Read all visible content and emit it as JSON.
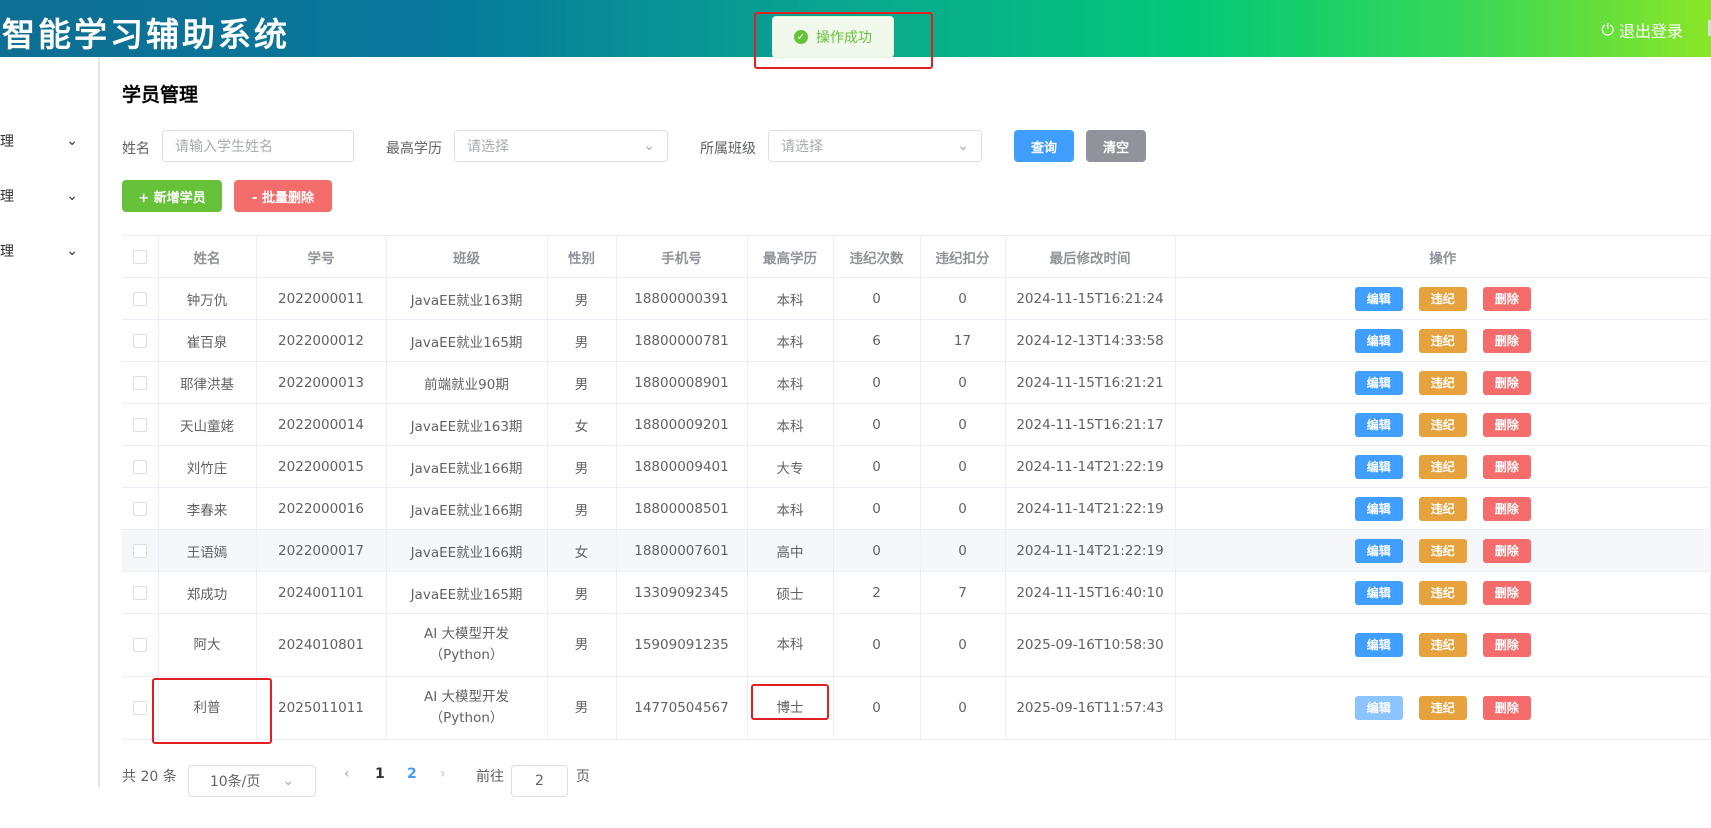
{
  "header": {
    "logo": "智能学习辅助系统",
    "logout": "退出登录"
  },
  "toast": {
    "message": "操作成功"
  },
  "sidebar": {
    "items": [
      {
        "label": "理"
      },
      {
        "label": "理"
      },
      {
        "label": "理"
      }
    ]
  },
  "page": {
    "title": "学员管理"
  },
  "search": {
    "name_label": "姓名",
    "name_placeholder": "请输入学生姓名",
    "degree_label": "最高学历",
    "degree_placeholder": "请选择",
    "class_label": "所属班级",
    "class_placeholder": "请选择",
    "query": "查询",
    "clear": "清空"
  },
  "actions": {
    "add": "+ 新增学员",
    "batch_delete": "- 批量删除"
  },
  "table": {
    "headers": [
      "姓名",
      "学号",
      "班级",
      "性别",
      "手机号",
      "最高学历",
      "违纪次数",
      "违纪扣分",
      "最后修改时间",
      "操作"
    ],
    "row_buttons": {
      "edit": "编辑",
      "violation": "违纪",
      "delete": "删除"
    },
    "rows": [
      [
        "钟万仇",
        "2022000011",
        "JavaEE就业163期",
        "男",
        "18800000391",
        "本科",
        "0",
        "0",
        "2024-11-15T16:21:24"
      ],
      [
        "崔百泉",
        "2022000012",
        "JavaEE就业165期",
        "男",
        "18800000781",
        "本科",
        "6",
        "17",
        "2024-12-13T14:33:58"
      ],
      [
        "耶律洪基",
        "2022000013",
        "前端就业90期",
        "男",
        "18800008901",
        "本科",
        "0",
        "0",
        "2024-11-15T16:21:21"
      ],
      [
        "天山童姥",
        "2022000014",
        "JavaEE就业163期",
        "女",
        "18800009201",
        "本科",
        "0",
        "0",
        "2024-11-15T16:21:17"
      ],
      [
        "刘竹庄",
        "2022000015",
        "JavaEE就业166期",
        "男",
        "18800009401",
        "大专",
        "0",
        "0",
        "2024-11-14T21:22:19"
      ],
      [
        "李春来",
        "2022000016",
        "JavaEE就业166期",
        "男",
        "18800008501",
        "本科",
        "0",
        "0",
        "2024-11-14T21:22:19"
      ],
      [
        "王语嫣",
        "2022000017",
        "JavaEE就业166期",
        "女",
        "18800007601",
        "高中",
        "0",
        "0",
        "2024-11-14T21:22:19"
      ],
      [
        "郑成功",
        "2024001101",
        "JavaEE就业165期",
        "男",
        "13309092345",
        "硕士",
        "2",
        "7",
        "2024-11-15T16:40:10"
      ],
      [
        "阿大",
        "2024010801",
        "AI 大模型开发（Python）",
        "男",
        "15909091235",
        "本科",
        "0",
        "0",
        "2025-09-16T10:58:30"
      ],
      [
        "利普",
        "2025011011",
        "AI 大模型开发（Python）",
        "男",
        "14770504567",
        "博士",
        "0",
        "0",
        "2025-09-16T11:57:43"
      ]
    ]
  },
  "pagination": {
    "total": "共 20 条",
    "page_size": "10条/页",
    "pages": [
      "1",
      "2"
    ],
    "current": "2",
    "goto_label": "前往",
    "goto_value": "2",
    "page_suffix": "页"
  }
}
